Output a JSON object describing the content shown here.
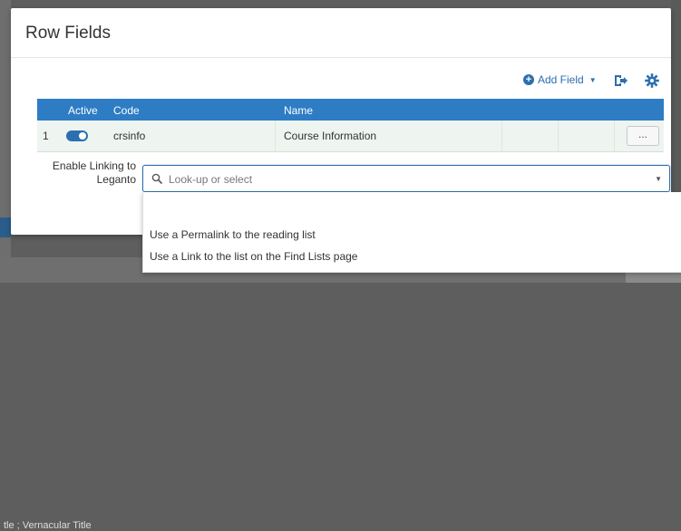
{
  "background": {
    "bottom_text": "tle ; Vernacular Title"
  },
  "modal": {
    "title": "Row Fields",
    "toolbar": {
      "add_field_label": "Add Field",
      "icons": [
        "plus-circle-icon",
        "export-icon",
        "gear-icon"
      ]
    },
    "table": {
      "headers": {
        "active": "Active",
        "code": "Code",
        "name": "Name"
      },
      "rows": [
        {
          "index": "1",
          "active": true,
          "code": "crsinfo",
          "name": "Course Information",
          "actions": "..."
        }
      ]
    },
    "link_field": {
      "label_line1": "Enable Linking to",
      "label_line2": "Leganto",
      "placeholder": "Look-up or select",
      "value": ""
    },
    "dropdown_options": [
      "Use a Permalink to the reading list",
      "Use a Link to the list on the Find Lists page"
    ]
  },
  "colors": {
    "header_blue": "#2e7cc4",
    "accent": "#2c6fb0",
    "row_bg": "#eef4ef"
  }
}
